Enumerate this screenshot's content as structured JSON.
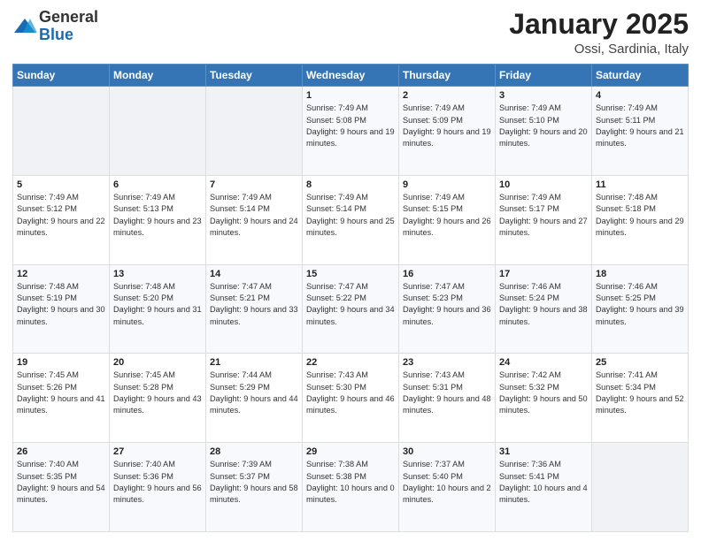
{
  "header": {
    "logo_general": "General",
    "logo_blue": "Blue",
    "month": "January 2025",
    "location": "Ossi, Sardinia, Italy"
  },
  "weekdays": [
    "Sunday",
    "Monday",
    "Tuesday",
    "Wednesday",
    "Thursday",
    "Friday",
    "Saturday"
  ],
  "weeks": [
    [
      {
        "day": "",
        "sunrise": "",
        "sunset": "",
        "daylight": ""
      },
      {
        "day": "",
        "sunrise": "",
        "sunset": "",
        "daylight": ""
      },
      {
        "day": "",
        "sunrise": "",
        "sunset": "",
        "daylight": ""
      },
      {
        "day": "1",
        "sunrise": "Sunrise: 7:49 AM",
        "sunset": "Sunset: 5:08 PM",
        "daylight": "Daylight: 9 hours and 19 minutes."
      },
      {
        "day": "2",
        "sunrise": "Sunrise: 7:49 AM",
        "sunset": "Sunset: 5:09 PM",
        "daylight": "Daylight: 9 hours and 19 minutes."
      },
      {
        "day": "3",
        "sunrise": "Sunrise: 7:49 AM",
        "sunset": "Sunset: 5:10 PM",
        "daylight": "Daylight: 9 hours and 20 minutes."
      },
      {
        "day": "4",
        "sunrise": "Sunrise: 7:49 AM",
        "sunset": "Sunset: 5:11 PM",
        "daylight": "Daylight: 9 hours and 21 minutes."
      }
    ],
    [
      {
        "day": "5",
        "sunrise": "Sunrise: 7:49 AM",
        "sunset": "Sunset: 5:12 PM",
        "daylight": "Daylight: 9 hours and 22 minutes."
      },
      {
        "day": "6",
        "sunrise": "Sunrise: 7:49 AM",
        "sunset": "Sunset: 5:13 PM",
        "daylight": "Daylight: 9 hours and 23 minutes."
      },
      {
        "day": "7",
        "sunrise": "Sunrise: 7:49 AM",
        "sunset": "Sunset: 5:14 PM",
        "daylight": "Daylight: 9 hours and 24 minutes."
      },
      {
        "day": "8",
        "sunrise": "Sunrise: 7:49 AM",
        "sunset": "Sunset: 5:14 PM",
        "daylight": "Daylight: 9 hours and 25 minutes."
      },
      {
        "day": "9",
        "sunrise": "Sunrise: 7:49 AM",
        "sunset": "Sunset: 5:15 PM",
        "daylight": "Daylight: 9 hours and 26 minutes."
      },
      {
        "day": "10",
        "sunrise": "Sunrise: 7:49 AM",
        "sunset": "Sunset: 5:17 PM",
        "daylight": "Daylight: 9 hours and 27 minutes."
      },
      {
        "day": "11",
        "sunrise": "Sunrise: 7:48 AM",
        "sunset": "Sunset: 5:18 PM",
        "daylight": "Daylight: 9 hours and 29 minutes."
      }
    ],
    [
      {
        "day": "12",
        "sunrise": "Sunrise: 7:48 AM",
        "sunset": "Sunset: 5:19 PM",
        "daylight": "Daylight: 9 hours and 30 minutes."
      },
      {
        "day": "13",
        "sunrise": "Sunrise: 7:48 AM",
        "sunset": "Sunset: 5:20 PM",
        "daylight": "Daylight: 9 hours and 31 minutes."
      },
      {
        "day": "14",
        "sunrise": "Sunrise: 7:47 AM",
        "sunset": "Sunset: 5:21 PM",
        "daylight": "Daylight: 9 hours and 33 minutes."
      },
      {
        "day": "15",
        "sunrise": "Sunrise: 7:47 AM",
        "sunset": "Sunset: 5:22 PM",
        "daylight": "Daylight: 9 hours and 34 minutes."
      },
      {
        "day": "16",
        "sunrise": "Sunrise: 7:47 AM",
        "sunset": "Sunset: 5:23 PM",
        "daylight": "Daylight: 9 hours and 36 minutes."
      },
      {
        "day": "17",
        "sunrise": "Sunrise: 7:46 AM",
        "sunset": "Sunset: 5:24 PM",
        "daylight": "Daylight: 9 hours and 38 minutes."
      },
      {
        "day": "18",
        "sunrise": "Sunrise: 7:46 AM",
        "sunset": "Sunset: 5:25 PM",
        "daylight": "Daylight: 9 hours and 39 minutes."
      }
    ],
    [
      {
        "day": "19",
        "sunrise": "Sunrise: 7:45 AM",
        "sunset": "Sunset: 5:26 PM",
        "daylight": "Daylight: 9 hours and 41 minutes."
      },
      {
        "day": "20",
        "sunrise": "Sunrise: 7:45 AM",
        "sunset": "Sunset: 5:28 PM",
        "daylight": "Daylight: 9 hours and 43 minutes."
      },
      {
        "day": "21",
        "sunrise": "Sunrise: 7:44 AM",
        "sunset": "Sunset: 5:29 PM",
        "daylight": "Daylight: 9 hours and 44 minutes."
      },
      {
        "day": "22",
        "sunrise": "Sunrise: 7:43 AM",
        "sunset": "Sunset: 5:30 PM",
        "daylight": "Daylight: 9 hours and 46 minutes."
      },
      {
        "day": "23",
        "sunrise": "Sunrise: 7:43 AM",
        "sunset": "Sunset: 5:31 PM",
        "daylight": "Daylight: 9 hours and 48 minutes."
      },
      {
        "day": "24",
        "sunrise": "Sunrise: 7:42 AM",
        "sunset": "Sunset: 5:32 PM",
        "daylight": "Daylight: 9 hours and 50 minutes."
      },
      {
        "day": "25",
        "sunrise": "Sunrise: 7:41 AM",
        "sunset": "Sunset: 5:34 PM",
        "daylight": "Daylight: 9 hours and 52 minutes."
      }
    ],
    [
      {
        "day": "26",
        "sunrise": "Sunrise: 7:40 AM",
        "sunset": "Sunset: 5:35 PM",
        "daylight": "Daylight: 9 hours and 54 minutes."
      },
      {
        "day": "27",
        "sunrise": "Sunrise: 7:40 AM",
        "sunset": "Sunset: 5:36 PM",
        "daylight": "Daylight: 9 hours and 56 minutes."
      },
      {
        "day": "28",
        "sunrise": "Sunrise: 7:39 AM",
        "sunset": "Sunset: 5:37 PM",
        "daylight": "Daylight: 9 hours and 58 minutes."
      },
      {
        "day": "29",
        "sunrise": "Sunrise: 7:38 AM",
        "sunset": "Sunset: 5:38 PM",
        "daylight": "Daylight: 10 hours and 0 minutes."
      },
      {
        "day": "30",
        "sunrise": "Sunrise: 7:37 AM",
        "sunset": "Sunset: 5:40 PM",
        "daylight": "Daylight: 10 hours and 2 minutes."
      },
      {
        "day": "31",
        "sunrise": "Sunrise: 7:36 AM",
        "sunset": "Sunset: 5:41 PM",
        "daylight": "Daylight: 10 hours and 4 minutes."
      },
      {
        "day": "",
        "sunrise": "",
        "sunset": "",
        "daylight": ""
      }
    ]
  ]
}
